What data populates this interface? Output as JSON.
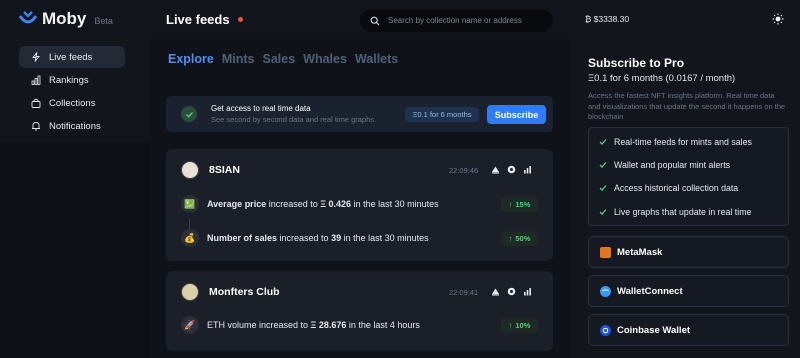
{
  "app": {
    "name": "Moby",
    "badge": "Beta"
  },
  "header": {
    "title": "Live feeds",
    "search_placeholder": "Search by collection name or address",
    "eth_price": "₿ $3338.30"
  },
  "sidebar": {
    "items": [
      {
        "label": "Live feeds",
        "icon": "bolt-icon",
        "active": true
      },
      {
        "label": "Rankings",
        "icon": "bar-chart-icon",
        "active": false
      },
      {
        "label": "Collections",
        "icon": "bag-icon",
        "active": false
      },
      {
        "label": "Notifications",
        "icon": "bell-icon",
        "active": false
      }
    ]
  },
  "tabs": [
    {
      "label": "Explore",
      "active": true
    },
    {
      "label": "Mints",
      "active": false
    },
    {
      "label": "Sales",
      "active": false
    },
    {
      "label": "Whales",
      "active": false
    },
    {
      "label": "Wallets",
      "active": false
    }
  ],
  "banner": {
    "title": "Get access to real time data",
    "subtitle": "See second by second data and real time graphs.",
    "price": "Ξ0.1 for 6 months",
    "button": "Subscribe"
  },
  "feed": [
    {
      "name": "8SIAN",
      "time": "22:09:46",
      "rows": [
        {
          "bold": "Average price",
          "mid": " increased to ",
          "value": "Ξ 0.426",
          "tail": " in the last 30 minutes",
          "pct": "15%",
          "icon": "chart-icon"
        },
        {
          "bold": "Number of sales",
          "mid": " increased to ",
          "value": "39",
          "tail": " in the last 30 minutes",
          "pct": "50%",
          "icon": "money-bag-icon"
        }
      ]
    },
    {
      "name": "Monfters Club",
      "time": "22:09:41",
      "rows": [
        {
          "bold": "",
          "mid": "ETH volume increased to ",
          "value": "Ξ 28.676",
          "tail": " in the last 4 hours",
          "pct": "10%",
          "icon": "rocket-icon"
        }
      ]
    }
  ],
  "pro": {
    "title": "Subscribe to Pro",
    "price": "Ξ0.1 for 6 months (0.0167 / month)",
    "description": "Access the fastest NFT insights platform. Real time data and visualizations that update the second it happens on the blockchain",
    "features": [
      "Real-time feeds for mints and sales",
      "Wallet and popular mint alerts",
      "Access historical collection data",
      "Live graphs that update in real time"
    ],
    "wallets": [
      {
        "label": "MetaMask",
        "color": "#e2761b"
      },
      {
        "label": "WalletConnect",
        "color": "#3b99fc"
      },
      {
        "label": "Coinbase Wallet",
        "color": "#1652f0"
      }
    ]
  },
  "colors": {
    "accent": "#2e7df6",
    "positive": "#4cd37a",
    "live": "#f0553a"
  }
}
